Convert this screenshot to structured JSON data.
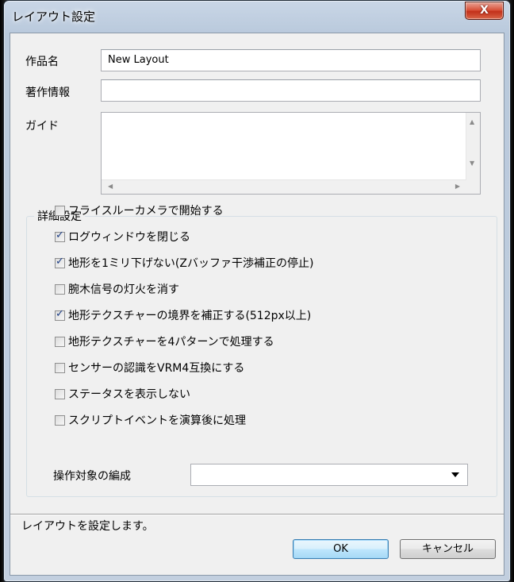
{
  "window": {
    "title": "レイアウト設定",
    "close_label": "X"
  },
  "form": {
    "title_label": "作品名",
    "title_value": "New Layout",
    "copyright_label": "著作情報",
    "copyright_value": "",
    "guide_label": "ガイド",
    "guide_value": ""
  },
  "advanced": {
    "group_label": "詳細設定",
    "options": [
      {
        "label": "フライスルーカメラで開始する",
        "checked": false
      },
      {
        "label": "ログウィンドウを閉じる",
        "checked": true
      },
      {
        "label": "地形を1ミリ下げない(Zバッファ干渉補正の停止)",
        "checked": true
      },
      {
        "label": "腕木信号の灯火を消す",
        "checked": false
      },
      {
        "label": "地形テクスチャーの境界を補正する(512px以上)",
        "checked": true
      },
      {
        "label": "地形テクスチャーを4パターンで処理する",
        "checked": false
      },
      {
        "label": "センサーの認識をVRM4互換にする",
        "checked": false
      },
      {
        "label": "ステータスを表示しない",
        "checked": false
      },
      {
        "label": "スクリプトイベントを演算後に処理",
        "checked": false
      }
    ],
    "control_target_label": "操作対象の編成",
    "control_target_value": ""
  },
  "status": {
    "message": "レイアウトを設定します。"
  },
  "buttons": {
    "ok": "OK",
    "cancel": "キャンセル"
  }
}
